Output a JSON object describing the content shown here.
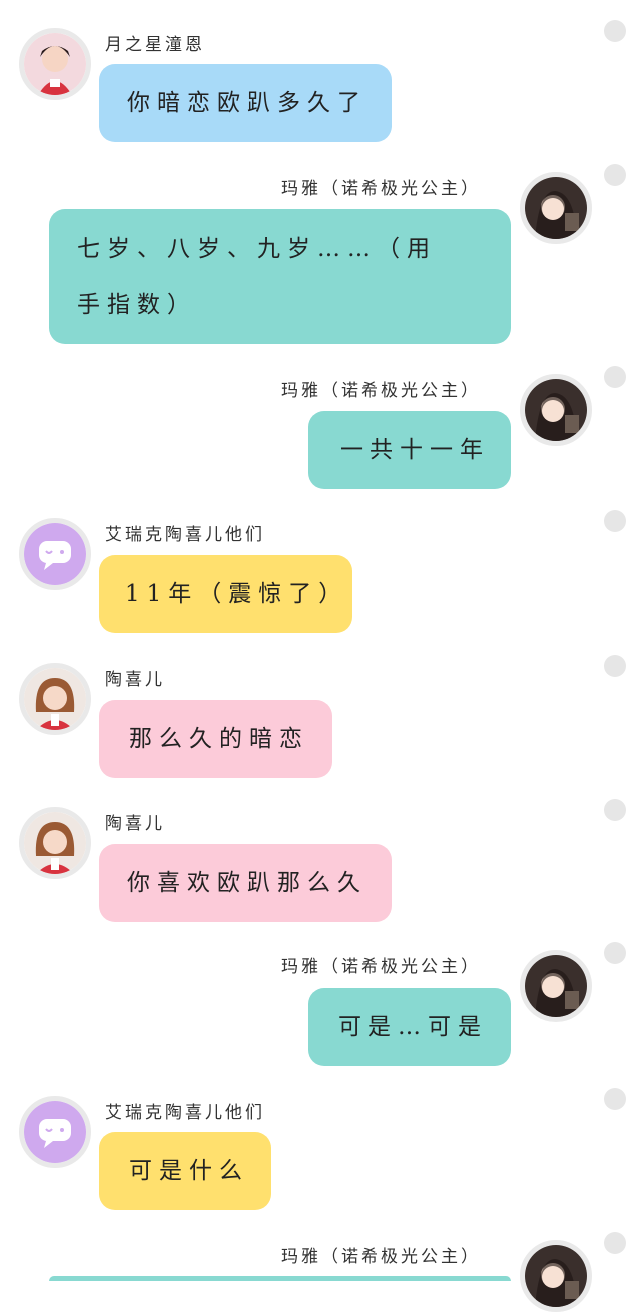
{
  "colors": {
    "blue_bubble": "#a8daf8",
    "teal_bubble": "#88d9d1",
    "yellow_bubble": "#ffe06e",
    "pink_bubble": "#fccbd9",
    "group_avatar": "#cfa9ee"
  },
  "messages": [
    {
      "sender": "月之星潼恩",
      "text": "你暗恋欧趴多久了",
      "avatar": "girl-red-hat-avatar"
    },
    {
      "sender": "玛雅（诺希极光公主）",
      "text": "七岁、八岁、九岁……（用手指数）",
      "avatar": "woman-dark-hair-avatar"
    },
    {
      "sender": "玛雅（诺希极光公主）",
      "text": "一共十一年",
      "avatar": "woman-dark-hair-avatar"
    },
    {
      "sender": "艾瑞克陶喜儿他们",
      "text": "11年（震惊了）",
      "avatar": "chat-bubble-icon"
    },
    {
      "sender": "陶喜儿",
      "text": "那么久的暗恋",
      "avatar": "girl-bob-hair-avatar"
    },
    {
      "sender": "陶喜儿",
      "text": "你喜欢欧趴那么久",
      "avatar": "girl-bob-hair-avatar"
    },
    {
      "sender": "玛雅（诺希极光公主）",
      "text": "可是…可是",
      "avatar": "woman-dark-hair-avatar"
    },
    {
      "sender": "艾瑞克陶喜儿他们",
      "text": "可是什么",
      "avatar": "chat-bubble-icon"
    },
    {
      "sender": "玛雅（诺希极光公主）",
      "text": "",
      "avatar": "woman-dark-hair-avatar"
    }
  ]
}
